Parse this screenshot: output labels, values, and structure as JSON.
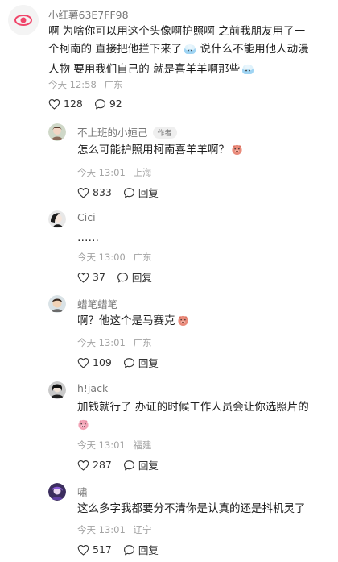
{
  "main_comment": {
    "username": "小红薯63E7FF98",
    "text_lines": [
      "啊 为啥你可以用这个头像啊护照啊 之前我朋友用了一",
      "个柯南的 直接把他拦下来了",
      " 说什么不能用他人动漫",
      "人物 要用我们自己的 就是喜羊羊啊那些"
    ],
    "time": "今天 12:58",
    "location": "广东",
    "likes": "128",
    "comments": "92"
  },
  "replies": [
    {
      "username": "不上班的小姮己",
      "tag": "作者",
      "text": "怎么可能护照用柯南喜羊羊啊？",
      "time": "今天 13:01",
      "location": "上海",
      "likes": "833",
      "reply_label": "回复"
    },
    {
      "username": "Cici",
      "text": "……",
      "time": "今天 13:00",
      "location": "广东",
      "likes": "37",
      "reply_label": "回复"
    },
    {
      "username": "蜡笔蜡笔",
      "text": "啊？他这个是马赛克",
      "time": "今天 13:01",
      "location": "广东",
      "likes": "109",
      "reply_label": "回复"
    },
    {
      "username": "h!jack",
      "text": "加钱就行了 办证的时候工作人员会让你选照片的",
      "time": "今天 13:01",
      "location": "福建",
      "likes": "287",
      "reply_label": "回复"
    },
    {
      "username": "嘯",
      "text": "这么多字我都要分不清你是认真的还是抖机灵了",
      "time": "今天 13:01",
      "location": "辽宁",
      "likes": "517",
      "reply_label": "回复"
    }
  ],
  "icons": {
    "like": "heart-outline-icon",
    "comment": "speech-bubble-icon",
    "reply": "speech-bubble-icon",
    "emoji_pig": "pig-face-emoji",
    "emoji_sheep": "sheep-emoji"
  },
  "colors": {
    "text": "#1f1f1f",
    "muted": "#a3a3a3",
    "avatar_eye": "#f0466a"
  }
}
